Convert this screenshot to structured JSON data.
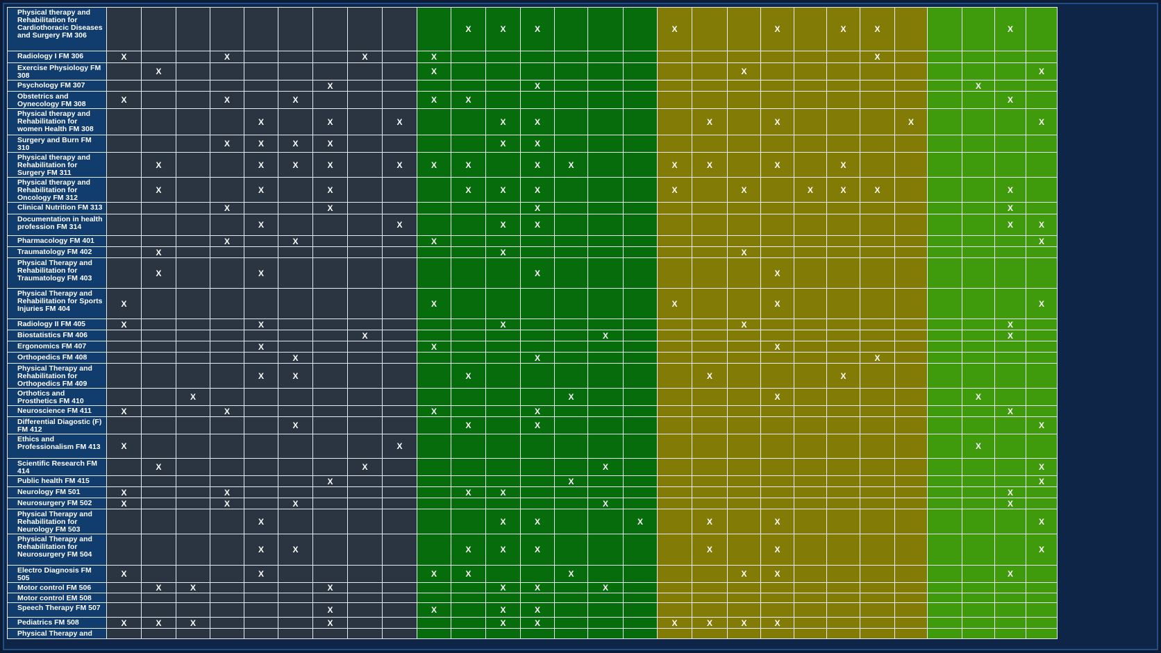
{
  "matrix": {
    "column_count": 28,
    "group_colors": [
      "#2b3542",
      "#076c0b",
      "#827c07",
      "#3f9b0c"
    ],
    "header_color": "#113c6e",
    "mark": "X",
    "rows": [
      {
        "course": "Physical therapy and Rehabilitation for Cardiothoracic Diseases and Surgery FM 306",
        "marks": [
          10,
          11,
          12,
          16,
          19,
          21,
          22,
          26
        ]
      },
      {
        "course": "Radiology I FM 306",
        "marks": [
          0,
          3,
          7,
          9,
          22
        ]
      },
      {
        "course": "Exercise Physiology FM 308",
        "marks": [
          1,
          9,
          18,
          27
        ]
      },
      {
        "course": "Psychology FM 307",
        "marks": [
          6,
          12,
          25
        ]
      },
      {
        "course": "Obstetrics and Oynecology FM 308",
        "marks": [
          0,
          3,
          5,
          9,
          10,
          26
        ]
      },
      {
        "course": "Physical therapy and Rehabilitation for women Health FM 308",
        "marks": [
          4,
          6,
          8,
          11,
          12,
          17,
          19,
          23,
          27
        ]
      },
      {
        "course": "Surgery and Burn FM 310",
        "marks": [
          3,
          4,
          5,
          6,
          11,
          12
        ]
      },
      {
        "course": "Physical therapy and Rehabilitation for Surgery FM 311",
        "marks": [
          1,
          4,
          5,
          6,
          8,
          9,
          10,
          12,
          13,
          16,
          17,
          19,
          21
        ]
      },
      {
        "course": "Physical therapy and Rehabilitation for Oncology FM 312",
        "marks": [
          1,
          4,
          6,
          10,
          11,
          12,
          16,
          18,
          20,
          21,
          22,
          26
        ]
      },
      {
        "course": "Clinical Nutrition FM 313",
        "marks": [
          3,
          6,
          12,
          26
        ]
      },
      {
        "course": "Documentation in health profession FM 314",
        "marks": [
          4,
          8,
          11,
          12,
          26,
          27
        ]
      },
      {
        "course": "Pharmacology FM 401",
        "marks": [
          3,
          5,
          9,
          27
        ]
      },
      {
        "course": "Traumatology FM 402",
        "marks": [
          1,
          11,
          18
        ]
      },
      {
        "course": "Physical Therapy and Rehabilitation for Traumatology FM 403",
        "marks": [
          1,
          4,
          12,
          19
        ]
      },
      {
        "course": "Physical Therapy and Rehabilitation for Sports Injuries FM 404",
        "marks": [
          0,
          9,
          16,
          19,
          27
        ]
      },
      {
        "course": "Radiology II FM 405",
        "marks": [
          0,
          4,
          11,
          18,
          26
        ]
      },
      {
        "course": "Biostatistics FM 406",
        "marks": [
          7,
          14,
          26
        ]
      },
      {
        "course": "Ergonomics FM 407",
        "marks": [
          4,
          9,
          19
        ]
      },
      {
        "course": "Orthopedics FM 408",
        "marks": [
          5,
          12,
          22
        ]
      },
      {
        "course": "Physical Therapy and Rehabilitation for Orthopedics FM 409",
        "marks": [
          4,
          5,
          10,
          17,
          21
        ]
      },
      {
        "course": "Orthotics and Prosthetics FM 410",
        "marks": [
          2,
          13,
          19,
          25
        ]
      },
      {
        "course": "Neuroscience FM 411",
        "marks": [
          0,
          3,
          9,
          12,
          26
        ]
      },
      {
        "course": "Differential Diagostic (F) FM 412",
        "marks": [
          5,
          10,
          12,
          27
        ]
      },
      {
        "course": "Ethics and Professionalism FM 413",
        "marks": [
          0,
          8,
          25
        ]
      },
      {
        "course": "Scientific Research FM 414",
        "marks": [
          1,
          7,
          14,
          27
        ]
      },
      {
        "course": "Public health FM 415",
        "marks": [
          6,
          13,
          27
        ]
      },
      {
        "course": "Neurology FM 501",
        "marks": [
          0,
          3,
          10,
          11,
          26
        ]
      },
      {
        "course": "Neurosurgery FM 502",
        "marks": [
          0,
          3,
          5,
          14,
          26
        ]
      },
      {
        "course": "Physical Therapy and Rehabilitation for Neurology FM 503",
        "marks": [
          4,
          11,
          12,
          15,
          17,
          19,
          27
        ]
      },
      {
        "course": "Physical Therapy and Rehabilitation for Neurosurgery FM 504",
        "marks": [
          4,
          5,
          10,
          11,
          12,
          17,
          19,
          27
        ]
      },
      {
        "course": "Electro Diagnosis FM 505",
        "marks": [
          0,
          4,
          9,
          10,
          13,
          18,
          19,
          26
        ]
      },
      {
        "course": "Motor control FM 506",
        "marks": [
          1,
          2,
          6,
          11,
          12,
          14
        ]
      },
      {
        "course": "Motor control EM 508",
        "marks": []
      },
      {
        "course": "Speech Therapy FM 507",
        "marks": [
          6,
          9,
          11,
          12
        ]
      },
      {
        "course": "Pediatrics FM 508",
        "marks": [
          0,
          1,
          2,
          6,
          11,
          12,
          16,
          17,
          18,
          19
        ]
      },
      {
        "course": "Physical Therapy and",
        "marks": []
      }
    ]
  }
}
